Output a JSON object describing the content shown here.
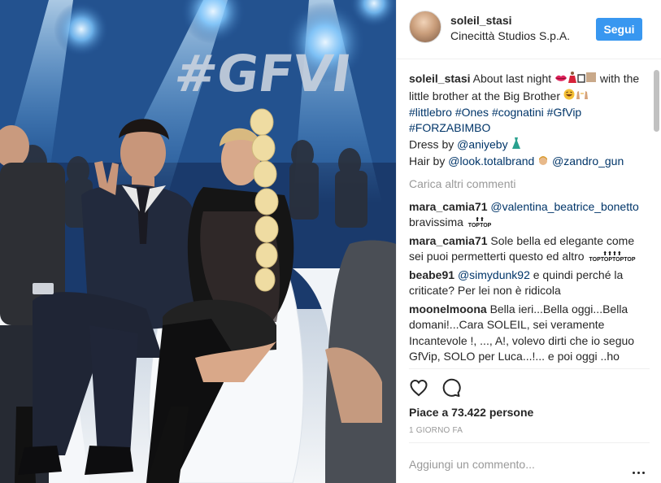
{
  "photo": {
    "alt_icon": "photo",
    "sign_text": "#GFVI"
  },
  "header": {
    "username": "soleil_stasi",
    "location": "Cinecittà Studios S.p.A.",
    "follow_label": "Segui"
  },
  "caption": {
    "username": "soleil_stasi",
    "text_1": "About last night",
    "text_2": "with the little brother at the Big Brother",
    "hashtags": [
      "#littlebro",
      "#Ones",
      "#cognatini",
      "#GfVip",
      "#FORZABIMBO"
    ],
    "dress_prefix": "Dress by",
    "dress_tag": "@aniyeby",
    "hair_prefix": "Hair by",
    "hair_tag_1": "@look.totalbrand",
    "hair_tag_2": "@zandro_gun"
  },
  "load_more_label": "Carica altri commenti",
  "comments": [
    {
      "user": "mara_camia71",
      "mention": "@valentina_beatrice_bonetto",
      "text": "bravissima"
    },
    {
      "user": "mara_camia71",
      "text": "Sole bella ed elegante come sei puoi permetterti questo ed altro"
    },
    {
      "user": "beabe91",
      "mention": "@simydunk92",
      "text": "e quindi perché la criticate? Per lei non è ridicola"
    },
    {
      "user": "moonelmoona",
      "text": "Bella ieri...Bella oggi...Bella domani!...Cara SOLEIL, sei veramente Incantevole !, ..., A!, volevo dirti che io seguo GfVip, SOLO per Luca...!... e poi oggi ..ho imparato tante"
    }
  ],
  "top_emoji_text": "TOP",
  "likes_text": "Piace a 73.422 persone",
  "time_text": "1 GIORNO FA",
  "add_comment_placeholder": "Aggiungi un commento...",
  "colors": {
    "accent": "#3897f0",
    "link": "#003569",
    "muted": "#999999",
    "border": "#efefef"
  },
  "icons": {
    "like": "heart-outline-icon",
    "comment": "comment-bubble-icon",
    "more": "more-options-icon"
  }
}
